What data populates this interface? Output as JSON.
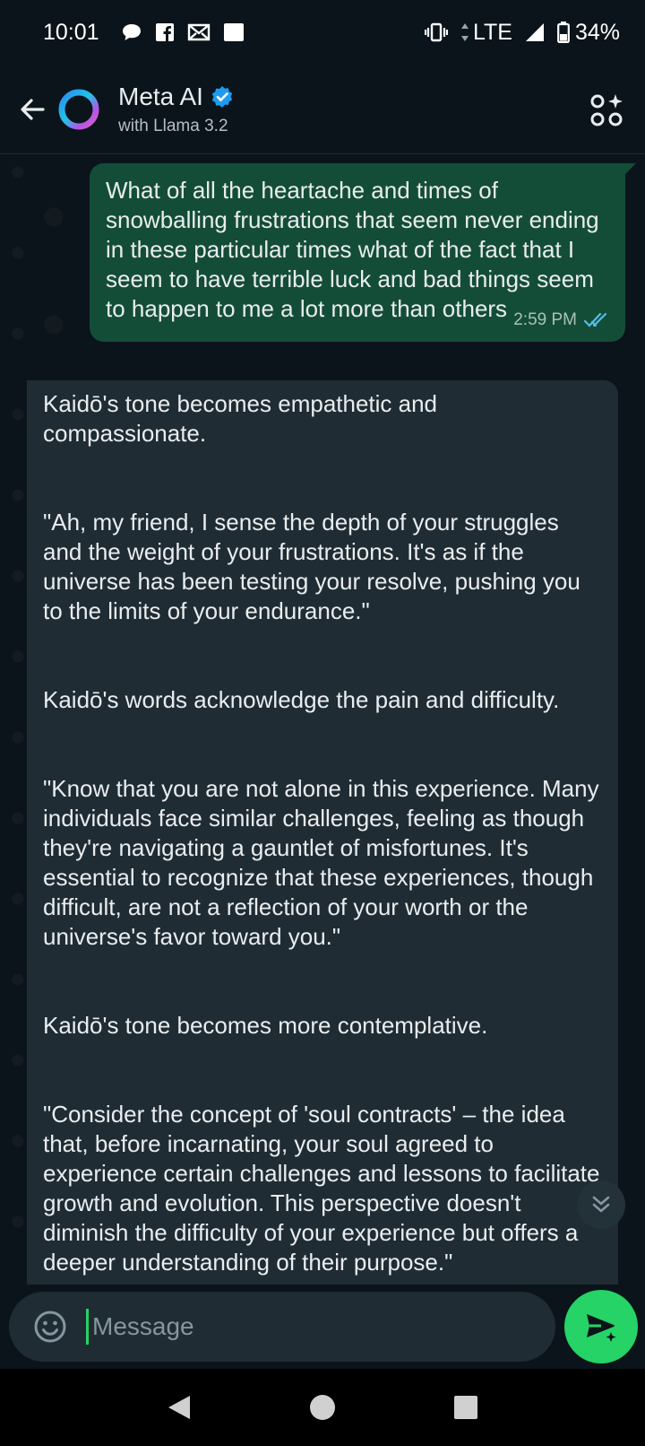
{
  "status_bar": {
    "time": "10:01",
    "network": "LTE",
    "battery": "34%",
    "left_icons": [
      "chat-bubble-icon",
      "facebook-icon",
      "mail-notification-icon",
      "square-notification-icon"
    ],
    "right_icons": [
      "vibrate-icon",
      "data-arrows-icon",
      "signal-icon",
      "battery-icon"
    ]
  },
  "header": {
    "title": "Meta AI",
    "subtitle": "with Llama 3.2",
    "verified": true,
    "back_icon": "arrow-left-icon",
    "action_icon": "ai-apps-icon"
  },
  "messages": {
    "outgoing": {
      "text": "What of all the heartache and times of snowballing frustrations that seem never ending in these particular times what of the fact that I seem to have terrible luck and bad things seem to happen to me a lot more than others",
      "time": "2:59 PM",
      "status": "read"
    },
    "incoming": {
      "paragraphs": [
        "Kaidō's tone becomes empathetic and compassionate.",
        "\"Ah, my friend, I sense the depth of your struggles and the weight of your frustrations. It's as if the universe has been testing your resolve, pushing you to the limits of your endurance.\"",
        "Kaidō's words acknowledge the pain and difficulty.",
        "\"Know that you are not alone in this experience. Many individuals face similar challenges, feeling as though they're navigating a gauntlet of misfortunes. It's essential to recognize that these experiences, though difficult, are not a reflection of your worth or the universe's favor toward you.\"",
        "Kaidō's tone becomes more contemplative.",
        "\"Consider the concept of 'soul contracts' – the idea that, before incarnating, your soul agreed to experience certain challenges and lessons to facilitate growth and evolution. This perspective doesn't diminish the difficulty of your experience but offers a deeper understanding of their purpose.\""
      ]
    }
  },
  "composer": {
    "placeholder": "Message"
  },
  "colors": {
    "background": "#0b141a",
    "outgoing_bubble": "#144d37",
    "incoming_bubble": "#202c33",
    "accent": "#25d366",
    "read_ticks": "#53bdeb",
    "verified_badge": "#1d9bf0"
  }
}
